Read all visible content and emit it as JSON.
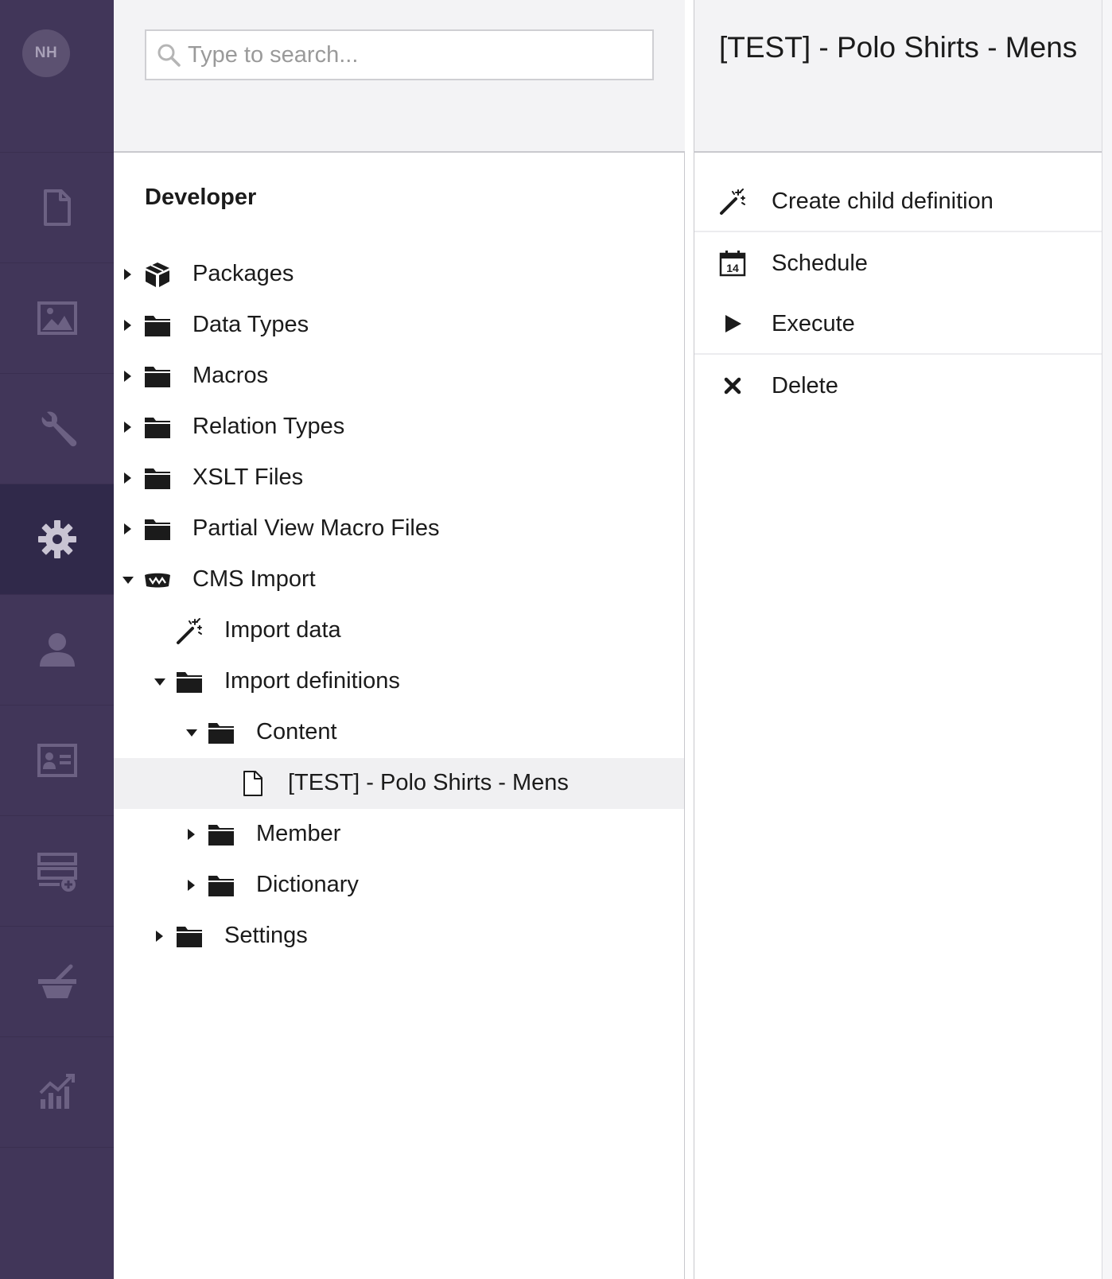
{
  "app_nav": {
    "avatar_initials": "NH",
    "items": [
      {
        "icon": "document-icon",
        "name": "content"
      },
      {
        "icon": "image-icon",
        "name": "media"
      },
      {
        "icon": "wrench-icon",
        "name": "settings"
      },
      {
        "icon": "gear-icon",
        "name": "developer",
        "active": true
      },
      {
        "icon": "user-icon",
        "name": "users"
      },
      {
        "icon": "id-card-icon",
        "name": "members"
      },
      {
        "icon": "form-add-icon",
        "name": "forms"
      },
      {
        "icon": "mortar-pestle-icon",
        "name": "translation"
      },
      {
        "icon": "chart-icon",
        "name": "analytics"
      }
    ]
  },
  "search": {
    "placeholder": "Type to search...",
    "value": ""
  },
  "tree": {
    "title": "Developer",
    "items": [
      {
        "label": "Packages",
        "icon": "package-icon",
        "caret": "right",
        "depth": 0
      },
      {
        "label": "Data Types",
        "icon": "folder-icon",
        "caret": "right",
        "depth": 0
      },
      {
        "label": "Macros",
        "icon": "folder-icon",
        "caret": "right",
        "depth": 0
      },
      {
        "label": "Relation Types",
        "icon": "folder-icon",
        "caret": "right",
        "depth": 0
      },
      {
        "label": "XSLT Files",
        "icon": "folder-icon",
        "caret": "right",
        "depth": 0
      },
      {
        "label": "Partial View Macro Files",
        "icon": "folder-icon",
        "caret": "right",
        "depth": 0
      },
      {
        "label": "CMS Import",
        "icon": "cms-import-logo-icon",
        "caret": "down",
        "depth": 0
      },
      {
        "label": "Import data",
        "icon": "magic-wand-icon",
        "caret": "none",
        "depth": 1
      },
      {
        "label": "Import definitions",
        "icon": "folder-icon",
        "caret": "down",
        "depth": 1
      },
      {
        "label": "Content",
        "icon": "folder-icon",
        "caret": "down",
        "depth": 2
      },
      {
        "label": "[TEST] - Polo Shirts - Mens",
        "icon": "document-outline-icon",
        "caret": "none",
        "depth": 3,
        "selected": true
      },
      {
        "label": "Member",
        "icon": "folder-icon",
        "caret": "right",
        "depth": 2
      },
      {
        "label": "Dictionary",
        "icon": "folder-icon",
        "caret": "right",
        "depth": 2
      },
      {
        "label": "Settings",
        "icon": "folder-icon",
        "caret": "right",
        "depth": 1
      }
    ]
  },
  "actions": {
    "title": "[TEST] - Polo Shirts - Mens",
    "items": [
      {
        "label": "Create child definition",
        "icon": "magic-wand-icon"
      },
      {
        "label": "Schedule",
        "icon": "calendar-icon",
        "calendar_day": "14"
      },
      {
        "label": "Execute",
        "icon": "play-icon"
      },
      {
        "label": "Delete",
        "icon": "close-icon"
      }
    ]
  },
  "colors": {
    "nav_bg": "#413659",
    "nav_active_bg": "#30294a",
    "nav_icon": "#6c6183",
    "nav_icon_active": "#c9c4d3",
    "header_bg": "#f3f3f5",
    "selected_row_bg": "#f0f0f2"
  }
}
